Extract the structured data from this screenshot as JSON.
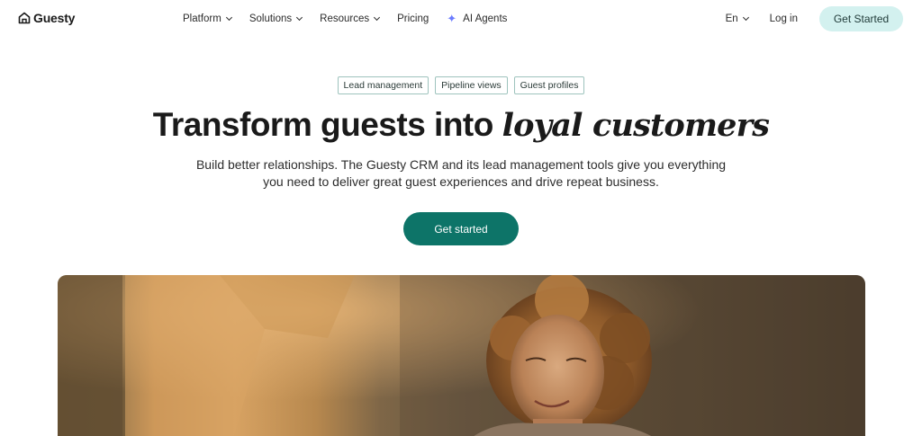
{
  "brand": {
    "name": "Guesty"
  },
  "nav": {
    "items": [
      {
        "label": "Platform",
        "dropdown": true
      },
      {
        "label": "Solutions",
        "dropdown": true
      },
      {
        "label": "Resources",
        "dropdown": true
      },
      {
        "label": "Pricing",
        "dropdown": false
      },
      {
        "label": "AI Agents",
        "dropdown": false,
        "icon": "sparkle-icon"
      }
    ],
    "language": "En",
    "login": "Log in",
    "cta": "Get Started"
  },
  "hero": {
    "tags": [
      "Lead management",
      "Pipeline views",
      "Guest profiles"
    ],
    "headline_plain": "Transform guests into ",
    "headline_italic": "loyal customers",
    "subtext": "Build better relationships. The Guesty CRM and its lead management tools give you everything you need to deliver great guest experiences and drive repeat business.",
    "cta": "Get started"
  },
  "colors": {
    "accent": "#0d7468",
    "cta_top_bg": "#d3f1ef",
    "chip_border": "#9ec3bd",
    "sparkle": "#6b7cff"
  }
}
